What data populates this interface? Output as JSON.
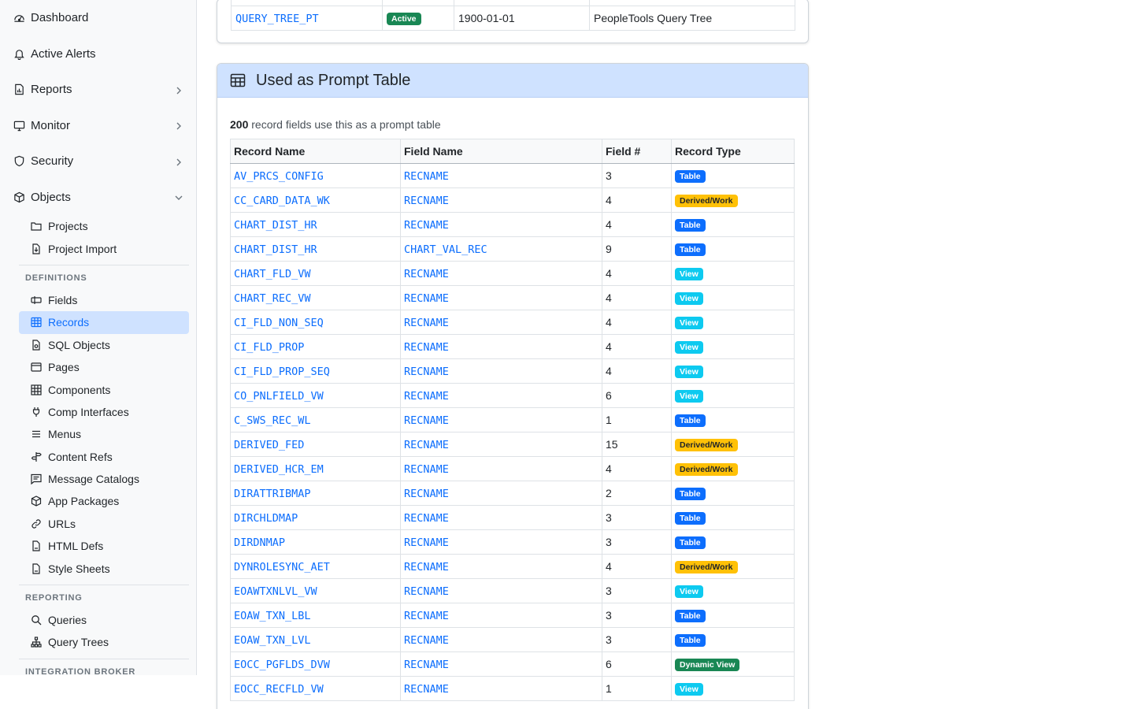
{
  "sidebar": {
    "top_items": [
      {
        "label": "Dashboard",
        "icon": "dashboard-icon"
      },
      {
        "label": "Active Alerts",
        "icon": "bell-icon"
      },
      {
        "label": "Reports",
        "icon": "report-icon"
      },
      {
        "label": "Monitor",
        "icon": "monitor-icon"
      },
      {
        "label": "Security",
        "icon": "shield-icon"
      },
      {
        "label": "Objects",
        "icon": "box-icon"
      }
    ],
    "object_items": [
      {
        "label": "Projects",
        "icon": "folder-icon"
      },
      {
        "label": "Project Import",
        "icon": "file-import-icon"
      }
    ],
    "definitions_heading": "DEFINITIONS",
    "definition_items": [
      {
        "label": "Fields",
        "icon": "field-icon"
      },
      {
        "label": "Records",
        "icon": "table-icon"
      },
      {
        "label": "SQL Objects",
        "icon": "sql-file-icon"
      },
      {
        "label": "Pages",
        "icon": "page-icon"
      },
      {
        "label": "Components",
        "icon": "grid-icon"
      },
      {
        "label": "Comp Interfaces",
        "icon": "plug-icon"
      },
      {
        "label": "Menus",
        "icon": "menu-icon"
      },
      {
        "label": "Content Refs",
        "icon": "signpost-icon"
      },
      {
        "label": "Message Catalogs",
        "icon": "message-icon"
      },
      {
        "label": "App Packages",
        "icon": "package-icon"
      },
      {
        "label": "URLs",
        "icon": "link-icon"
      },
      {
        "label": "HTML Defs",
        "icon": "html-file-icon"
      },
      {
        "label": "Style Sheets",
        "icon": "css-file-icon"
      }
    ],
    "reporting_heading": "REPORTING",
    "reporting_items": [
      {
        "label": "Queries",
        "icon": "search-icon"
      },
      {
        "label": "Query Trees",
        "icon": "tree-icon"
      }
    ],
    "integration_heading": "INTEGRATION BROKER"
  },
  "tree_row": {
    "name": "QUERY_TREE_PT",
    "status": "Active",
    "date": "1900-01-01",
    "description": "PeopleTools Query Tree"
  },
  "prompt_card": {
    "title": "Used as Prompt Table",
    "count": "200",
    "summary_text": "record fields use this as a prompt table",
    "columns": [
      "Record Name",
      "Field Name",
      "Field #",
      "Record Type"
    ],
    "rows": [
      {
        "record": "AV_PRCS_CONFIG",
        "field": "RECNAME",
        "num": "3",
        "type": "Table"
      },
      {
        "record": "CC_CARD_DATA_WK",
        "field": "RECNAME",
        "num": "4",
        "type": "Derived/Work"
      },
      {
        "record": "CHART_DIST_HR",
        "field": "RECNAME",
        "num": "4",
        "type": "Table"
      },
      {
        "record": "CHART_DIST_HR",
        "field": "CHART_VAL_REC",
        "num": "9",
        "type": "Table"
      },
      {
        "record": "CHART_FLD_VW",
        "field": "RECNAME",
        "num": "4",
        "type": "View"
      },
      {
        "record": "CHART_REC_VW",
        "field": "RECNAME",
        "num": "4",
        "type": "View"
      },
      {
        "record": "CI_FLD_NON_SEQ",
        "field": "RECNAME",
        "num": "4",
        "type": "View"
      },
      {
        "record": "CI_FLD_PROP",
        "field": "RECNAME",
        "num": "4",
        "type": "View"
      },
      {
        "record": "CI_FLD_PROP_SEQ",
        "field": "RECNAME",
        "num": "4",
        "type": "View"
      },
      {
        "record": "CO_PNLFIELD_VW",
        "field": "RECNAME",
        "num": "6",
        "type": "View"
      },
      {
        "record": "C_SWS_REC_WL",
        "field": "RECNAME",
        "num": "1",
        "type": "Table"
      },
      {
        "record": "DERIVED_FED",
        "field": "RECNAME",
        "num": "15",
        "type": "Derived/Work"
      },
      {
        "record": "DERIVED_HCR_EM",
        "field": "RECNAME",
        "num": "4",
        "type": "Derived/Work"
      },
      {
        "record": "DIRATTRIBMAP",
        "field": "RECNAME",
        "num": "2",
        "type": "Table"
      },
      {
        "record": "DIRCHLDMAP",
        "field": "RECNAME",
        "num": "3",
        "type": "Table"
      },
      {
        "record": "DIRDNMAP",
        "field": "RECNAME",
        "num": "3",
        "type": "Table"
      },
      {
        "record": "DYNROLESYNC_AET",
        "field": "RECNAME",
        "num": "4",
        "type": "Derived/Work"
      },
      {
        "record": "EOAWTXNLVL_VW",
        "field": "RECNAME",
        "num": "3",
        "type": "View"
      },
      {
        "record": "EOAW_TXN_LBL",
        "field": "RECNAME",
        "num": "3",
        "type": "Table"
      },
      {
        "record": "EOAW_TXN_LVL",
        "field": "RECNAME",
        "num": "3",
        "type": "Table"
      },
      {
        "record": "EOCC_PGFLDS_DVW",
        "field": "RECNAME",
        "num": "6",
        "type": "Dynamic View"
      },
      {
        "record": "EOCC_RECFLD_VW",
        "field": "RECNAME",
        "num": "1",
        "type": "View"
      }
    ]
  },
  "colors": {
    "accent": "#0d6efd",
    "header_bg": "#cfe2ff",
    "badge_table": "#0d6efd",
    "badge_derived": "#ffc107",
    "badge_view": "#0dcaf0",
    "badge_dynamic": "#198754"
  }
}
